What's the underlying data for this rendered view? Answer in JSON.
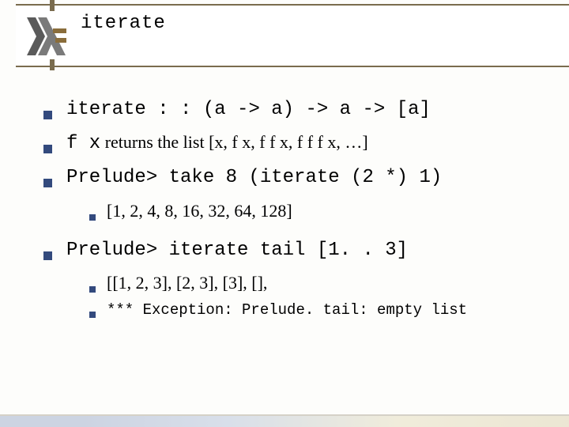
{
  "title": "iterate",
  "lines": {
    "l1_mono": "iterate : : (a -> a) -> a -> [a]",
    "l2_mono_a": "f x",
    "l2_serif": " returns the list [x, f x, f f x, f f f x, …]",
    "l3_mono": "Prelude> take 8 (iterate (2 *) 1)",
    "s1": "[1, 2, 4, 8, 16, 32, 64, 128]",
    "l4_mono": "Prelude> iterate tail [1. . 3]",
    "s2": "[[1, 2, 3], [2, 3], [3], [],",
    "s3": "*** Exception: Prelude. tail: empty list"
  }
}
